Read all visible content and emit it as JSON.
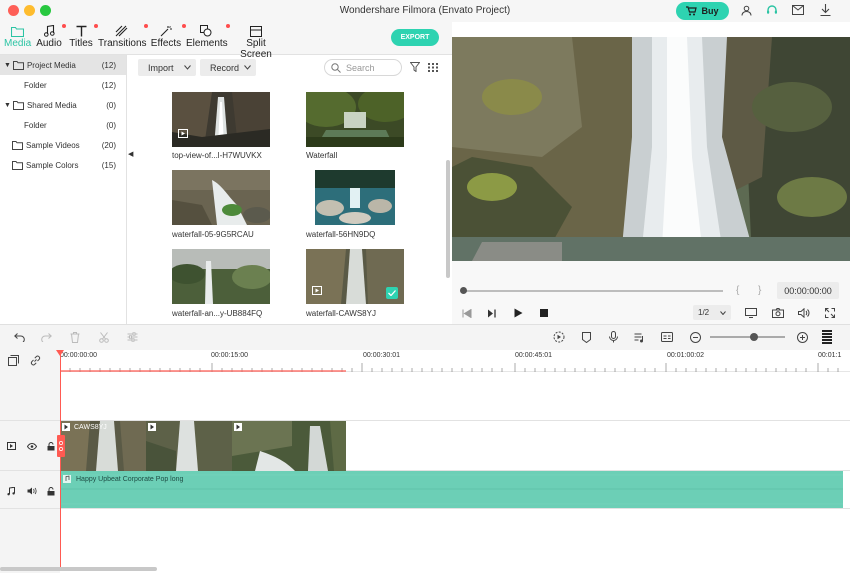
{
  "window": {
    "title": "Wondershare Filmora (Envato Project)",
    "buy_label": "Buy"
  },
  "toolbar": {
    "tabs": [
      {
        "label": "Media",
        "icon": "folder-icon",
        "active": true
      },
      {
        "label": "Audio",
        "icon": "music-icon",
        "badge": true
      },
      {
        "label": "Titles",
        "icon": "text-icon",
        "badge": true
      },
      {
        "label": "Transitions",
        "icon": "transition-icon",
        "badge": true
      },
      {
        "label": "Effects",
        "icon": "effects-icon",
        "badge": true
      },
      {
        "label": "Elements",
        "icon": "elements-icon",
        "badge": true
      },
      {
        "label": "Split Screen",
        "icon": "split-screen-icon"
      }
    ],
    "export_label": "EXPORT"
  },
  "tree": {
    "items": [
      {
        "label": "Project Media",
        "count": "(12)"
      },
      {
        "label": "Folder",
        "count": "(12)"
      },
      {
        "label": "Shared Media",
        "count": "(0)"
      },
      {
        "label": "Folder",
        "count": "(0)"
      },
      {
        "label": "Sample Videos",
        "count": "(20)"
      },
      {
        "label": "Sample Colors",
        "count": "(15)"
      }
    ]
  },
  "media": {
    "import_label": "Import",
    "record_label": "Record",
    "search_placeholder": "Search",
    "items": [
      {
        "label": "top-view-of...l-H7WUVKX"
      },
      {
        "label": "Waterfall"
      },
      {
        "label": "waterfall-05-9G5RCAU"
      },
      {
        "label": "waterfall-56HN9DQ"
      },
      {
        "label": "waterfall-an...y-UB884FQ"
      },
      {
        "label": "waterfall-CAWS8YJ"
      }
    ]
  },
  "preview": {
    "timecode": "00:00:00:00",
    "ratio": "1/2"
  },
  "timeline": {
    "ruler_labels": [
      "00:00:00:00",
      "00:00:15:00",
      "00:00:30:01",
      "00:00:45:01",
      "00:01:00:02",
      "00:01:1"
    ],
    "video_clip_label": "CAWS8YJ",
    "audio_clip_label": "Happy Upbeat Corporate Pop long"
  },
  "colors": {
    "accent": "#2ed3b1",
    "playhead": "#ff5a52",
    "audio_clip": "#6ccfb6"
  }
}
